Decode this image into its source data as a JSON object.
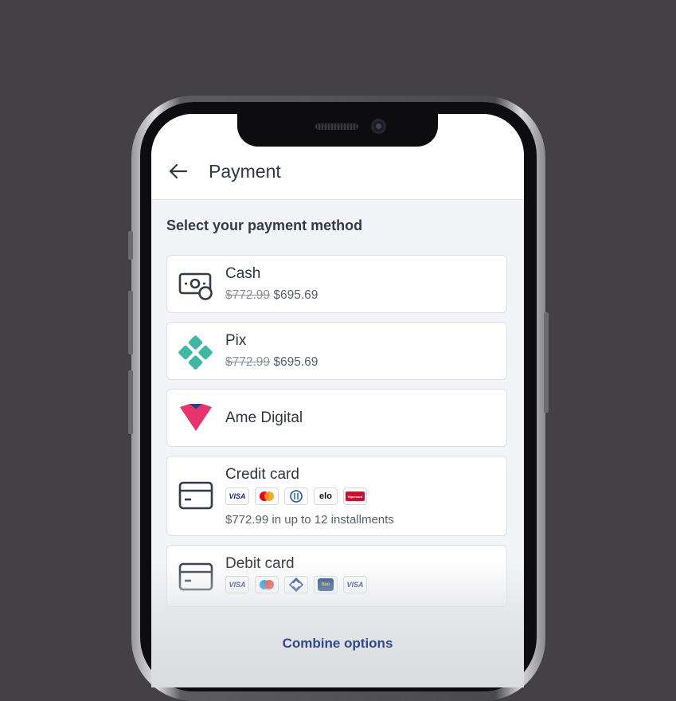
{
  "header": {
    "title": "Payment",
    "back_icon": "arrow-left-icon"
  },
  "section_title": "Select your payment method",
  "methods": [
    {
      "name": "Cash",
      "icon": "cash-icon",
      "old_price": "$772.99",
      "price": "$695.69"
    },
    {
      "name": "Pix",
      "icon": "pix-icon",
      "icon_color": "#3fb8a3",
      "old_price": "$772.99",
      "price": "$695.69"
    },
    {
      "name": "Ame Digital",
      "icon": "ame-heart-icon",
      "icon_color": "#e8336c"
    },
    {
      "name": "Credit card",
      "icon": "credit-card-icon",
      "brands": [
        "VISA",
        "mastercard",
        "diners",
        "elo",
        "hipercard"
      ],
      "installments": "$772.99 in up to 12 installments"
    },
    {
      "name": "Debit card",
      "icon": "debit-card-icon",
      "brands": [
        "VISA",
        "maestro",
        "banco-do-brasil",
        "Itaú",
        "VISA"
      ]
    }
  ],
  "combine_label": "Combine options",
  "colors": {
    "accent": "#2c4a8f",
    "background": "#434146",
    "screen": "#f3f4f8"
  },
  "elo_label": "elo",
  "itau_label": "Itaú",
  "visa_label": "VISA",
  "hipercard_label": "Hipercard"
}
